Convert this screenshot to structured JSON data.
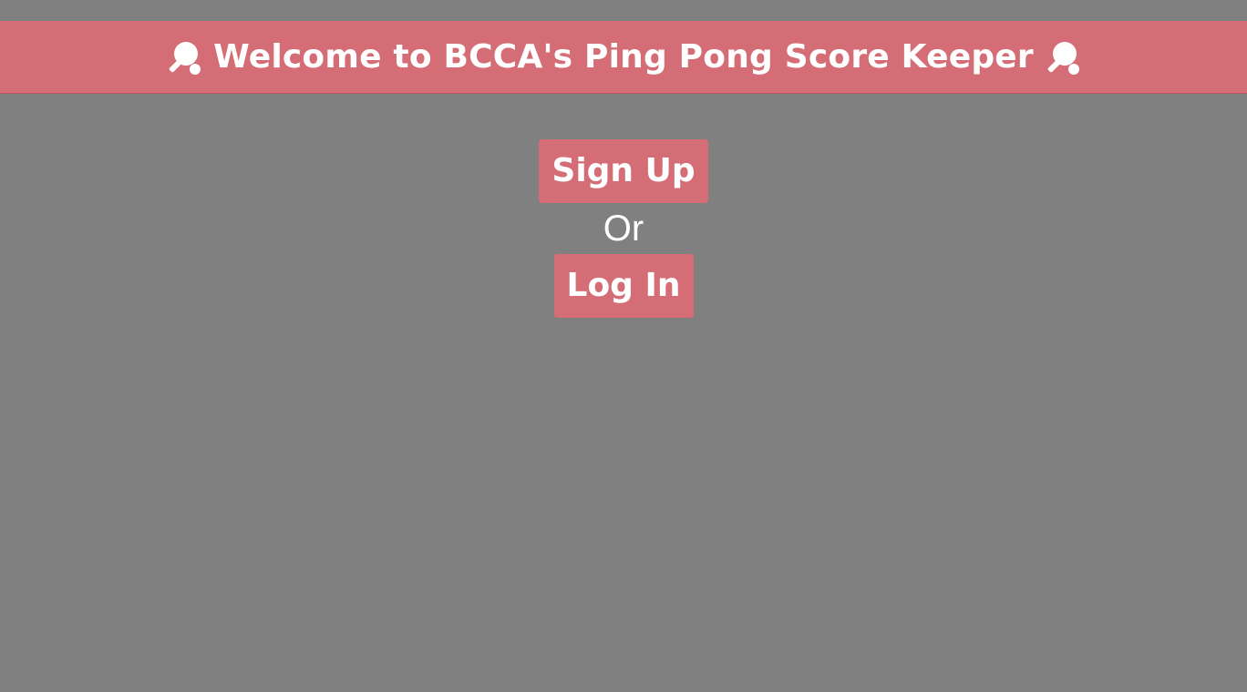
{
  "header": {
    "title": "Welcome to BCCA's Ping Pong Score Keeper",
    "left_icon": "ping-pong-icon",
    "right_icon": "ping-pong-icon"
  },
  "auth": {
    "signup_label": "Sign Up",
    "or_label": "Or",
    "login_label": "Log In"
  },
  "colors": {
    "background": "#808080",
    "accent": "#d46d76",
    "text": "#ffffff"
  }
}
